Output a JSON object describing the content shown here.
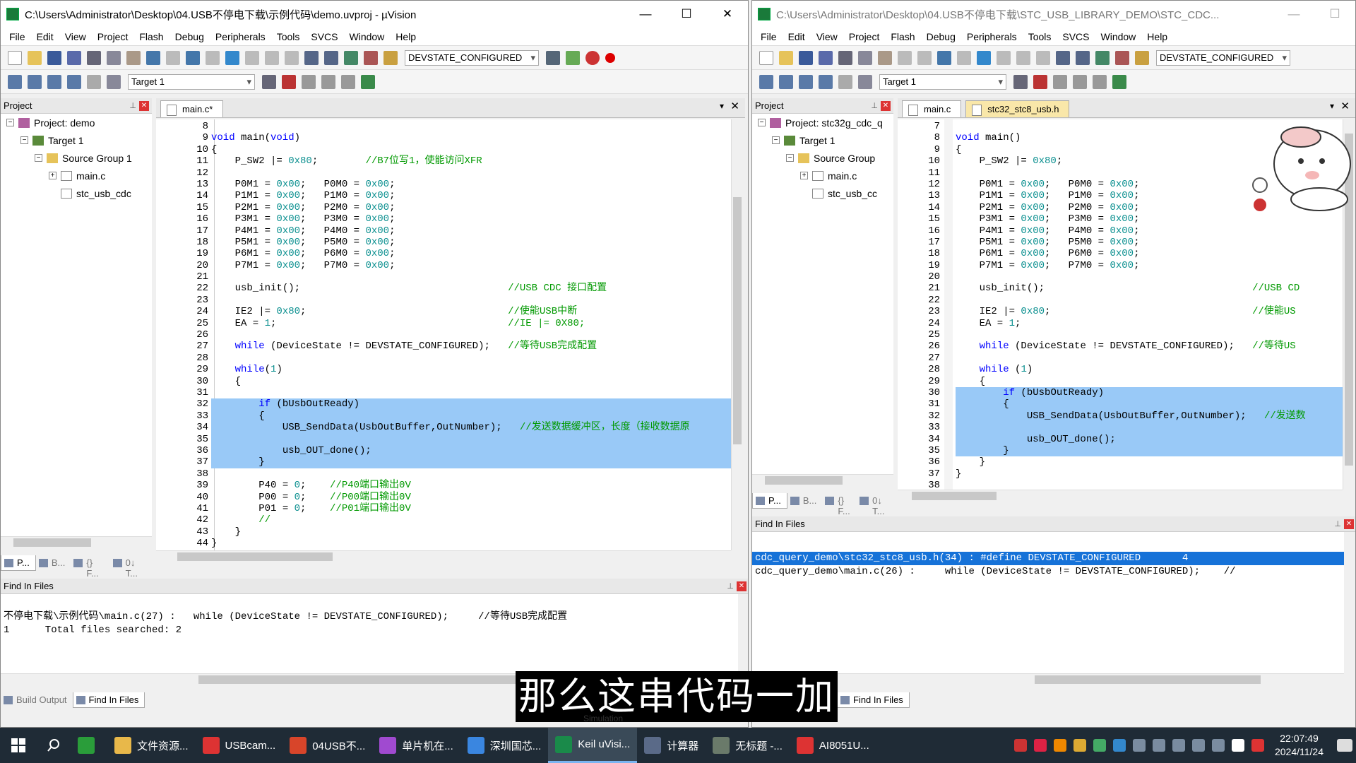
{
  "left_window": {
    "title": "C:\\Users\\Administrator\\Desktop\\04.USB不停电下载\\示例代码\\demo.uvproj - µVision",
    "controls": {
      "minimize": "—",
      "maximize": "☐",
      "close": "✕"
    },
    "menu": [
      "File",
      "Edit",
      "View",
      "Project",
      "Flash",
      "Debug",
      "Peripherals",
      "Tools",
      "SVCS",
      "Window",
      "Help"
    ],
    "find_combo": "DEVSTATE_CONFIGURED",
    "target_combo": "Target 1",
    "project_pane": {
      "header": "Project",
      "tree": [
        {
          "label": "Project: demo",
          "indent": 0,
          "icon": "project-icon",
          "exp": "−"
        },
        {
          "label": "Target 1",
          "indent": 1,
          "icon": "target-icon",
          "exp": "−"
        },
        {
          "label": "Source Group 1",
          "indent": 2,
          "icon": "folder-icon",
          "exp": "−"
        },
        {
          "label": "main.c",
          "indent": 3,
          "icon": "file-icon",
          "exp": "+"
        },
        {
          "label": "stc_usb_cdc",
          "indent": 3,
          "icon": "file-icon",
          "exp": ""
        }
      ],
      "bottom_tabs": [
        "P...",
        "B...",
        "{} F...",
        "0↓ T..."
      ]
    },
    "editor_tabs": [
      "main.c*"
    ],
    "code_start_line": 8,
    "code": [
      {
        "t": "",
        "cls": ""
      },
      {
        "t": "void main(void)",
        "cls": ""
      },
      {
        "t": "{",
        "cls": ""
      },
      {
        "t": "    P_SW2 |= 0x80;        //B7位写1，使能访问XFR",
        "cls": ""
      },
      {
        "t": "",
        "cls": ""
      },
      {
        "t": "    P0M1 = 0x00;   P0M0 = 0x00;",
        "cls": ""
      },
      {
        "t": "    P1M1 = 0x00;   P1M0 = 0x00;",
        "cls": ""
      },
      {
        "t": "    P2M1 = 0x00;   P2M0 = 0x00;",
        "cls": ""
      },
      {
        "t": "    P3M1 = 0x00;   P3M0 = 0x00;",
        "cls": ""
      },
      {
        "t": "    P4M1 = 0x00;   P4M0 = 0x00;",
        "cls": ""
      },
      {
        "t": "    P5M1 = 0x00;   P5M0 = 0x00;",
        "cls": ""
      },
      {
        "t": "    P6M1 = 0x00;   P6M0 = 0x00;",
        "cls": ""
      },
      {
        "t": "    P7M1 = 0x00;   P7M0 = 0x00;",
        "cls": ""
      },
      {
        "t": "",
        "cls": ""
      },
      {
        "t": "    usb_init();                                   //USB CDC 接口配置",
        "cls": ""
      },
      {
        "t": "",
        "cls": ""
      },
      {
        "t": "    IE2 |= 0x80;                                  //使能USB中断",
        "cls": ""
      },
      {
        "t": "    EA = 1;                                       //IE |= 0X80;",
        "cls": ""
      },
      {
        "t": "",
        "cls": ""
      },
      {
        "t": "    while (DeviceState != DEVSTATE_CONFIGURED);   //等待USB完成配置",
        "cls": ""
      },
      {
        "t": "",
        "cls": ""
      },
      {
        "t": "    while(1)",
        "cls": ""
      },
      {
        "t": "    {",
        "cls": ""
      },
      {
        "t": "",
        "cls": ""
      },
      {
        "t": "        if (bUsbOutReady)",
        "cls": "sel"
      },
      {
        "t": "        {",
        "cls": "sel"
      },
      {
        "t": "            USB_SendData(UsbOutBuffer,OutNumber);   //发送数据缓冲区，长度（接收数据原",
        "cls": "sel"
      },
      {
        "t": "",
        "cls": "sel"
      },
      {
        "t": "            usb_OUT_done();",
        "cls": "sel"
      },
      {
        "t": "        }",
        "cls": "sel"
      },
      {
        "t": "",
        "cls": ""
      },
      {
        "t": "        P40 = 0;    //P40端口输出0V",
        "cls": ""
      },
      {
        "t": "        P00 = 0;    //P00端口输出0V",
        "cls": ""
      },
      {
        "t": "        P01 = 0;    //P01端口输出0V",
        "cls": ""
      },
      {
        "t": "        //",
        "cls": ""
      },
      {
        "t": "    }",
        "cls": ""
      },
      {
        "t": "}",
        "cls": ""
      }
    ],
    "line_numbers": [
      "8",
      "9",
      "10",
      "11",
      "12",
      "13",
      "14",
      "15",
      "16",
      "17",
      "18",
      "19",
      "20",
      "21",
      "22",
      "23",
      "24",
      "25",
      "26",
      "27",
      "28",
      "29",
      "30",
      "31",
      "32",
      "33",
      "34",
      "35",
      "36",
      "37",
      "38",
      "39",
      "40",
      "41",
      "42",
      "43",
      "44"
    ],
    "find_panel": {
      "header": "Find In Files",
      "lines": [
        "",
        "不停电下载\\示例代码\\main.c(27) :   while (DeviceState != DEVSTATE_CONFIGURED);     //等待USB完成配置",
        "1      Total files searched: 2"
      ]
    },
    "bottom_tabs": [
      "Build Output",
      "Find In Files"
    ]
  },
  "right_window": {
    "title": "C:\\Users\\Administrator\\Desktop\\04.USB不停电下载\\STC_USB_LIBRARY_DEMO\\STC_CDC...",
    "menu": [
      "File",
      "Edit",
      "View",
      "Project",
      "Flash",
      "Debug",
      "Peripherals",
      "Tools",
      "SVCS",
      "Window",
      "Help"
    ],
    "find_combo": "DEVSTATE_CONFIGURED",
    "target_combo": "Target 1",
    "project_pane": {
      "header": "Project",
      "tree": [
        {
          "label": "Project: stc32g_cdc_q",
          "indent": 0,
          "icon": "project-icon",
          "exp": "−"
        },
        {
          "label": "Target 1",
          "indent": 1,
          "icon": "target-icon",
          "exp": "−"
        },
        {
          "label": "Source Group",
          "indent": 2,
          "icon": "folder-icon",
          "exp": "−"
        },
        {
          "label": "main.c",
          "indent": 3,
          "icon": "file-icon",
          "exp": "+"
        },
        {
          "label": "stc_usb_cc",
          "indent": 3,
          "icon": "file-icon",
          "exp": ""
        }
      ],
      "bottom_tabs": [
        "P...",
        "B...",
        "{} F...",
        "0↓ T..."
      ]
    },
    "editor_tabs": [
      "main.c",
      "stc32_stc8_usb.h"
    ],
    "code": [
      {
        "t": "",
        "cls": ""
      },
      {
        "t": "void main()",
        "cls": ""
      },
      {
        "t": "{",
        "cls": ""
      },
      {
        "t": "    P_SW2 |= 0x80;",
        "cls": ""
      },
      {
        "t": "",
        "cls": ""
      },
      {
        "t": "    P0M1 = 0x00;   P0M0 = 0x00;",
        "cls": ""
      },
      {
        "t": "    P1M1 = 0x00;   P1M0 = 0x00;",
        "cls": ""
      },
      {
        "t": "    P2M1 = 0x00;   P2M0 = 0x00;",
        "cls": ""
      },
      {
        "t": "    P3M1 = 0x00;   P3M0 = 0x00;",
        "cls": ""
      },
      {
        "t": "    P4M1 = 0x00;   P4M0 = 0x00;",
        "cls": ""
      },
      {
        "t": "    P5M1 = 0x00;   P5M0 = 0x00;",
        "cls": ""
      },
      {
        "t": "    P6M1 = 0x00;   P6M0 = 0x00;",
        "cls": ""
      },
      {
        "t": "    P7M1 = 0x00;   P7M0 = 0x00;",
        "cls": ""
      },
      {
        "t": "",
        "cls": ""
      },
      {
        "t": "    usb_init();                                   //USB CD",
        "cls": ""
      },
      {
        "t": "",
        "cls": ""
      },
      {
        "t": "    IE2 |= 0x80;                                  //使能US",
        "cls": ""
      },
      {
        "t": "    EA = 1;",
        "cls": ""
      },
      {
        "t": "",
        "cls": ""
      },
      {
        "t": "    while (DeviceState != DEVSTATE_CONFIGURED);   //等待US",
        "cls": ""
      },
      {
        "t": "",
        "cls": ""
      },
      {
        "t": "    while (1)",
        "cls": ""
      },
      {
        "t": "    {",
        "cls": ""
      },
      {
        "t": "        if (bUsbOutReady)",
        "cls": "sel"
      },
      {
        "t": "        {",
        "cls": "sel"
      },
      {
        "t": "            USB_SendData(UsbOutBuffer,OutNumber);   //发送数",
        "cls": "sel"
      },
      {
        "t": "",
        "cls": "sel"
      },
      {
        "t": "            usb_OUT_done();",
        "cls": "sel"
      },
      {
        "t": "        }",
        "cls": "sel"
      },
      {
        "t": "    }",
        "cls": ""
      },
      {
        "t": "}",
        "cls": ""
      },
      {
        "t": "",
        "cls": ""
      }
    ],
    "line_numbers": [
      "7",
      "8",
      "9",
      "10",
      "11",
      "12",
      "13",
      "14",
      "15",
      "16",
      "17",
      "18",
      "19",
      "20",
      "21",
      "22",
      "23",
      "24",
      "25",
      "26",
      "27",
      "28",
      "29",
      "30",
      "31",
      "32",
      "33",
      "34",
      "35",
      "36",
      "37",
      "38"
    ],
    "find_panel": {
      "header": "Find In Files",
      "lines": [
        "cdc_query_demo\\stc32_stc8_usb.h(34) : #define DEVSTATE_CONFIGURED       4",
        "cdc_query_demo\\main.c(26) :     while (DeviceState != DEVSTATE_CONFIGURED);    //"
      ]
    },
    "bottom_tabs": [
      "Find In Files"
    ]
  },
  "subtitle": "那么这串代码一加",
  "status_simulation": "Simulation",
  "taskbar": {
    "items": [
      {
        "label": "",
        "color": "#2a9d3a",
        "name": "wechat-icon"
      },
      {
        "label": "文件资源...",
        "color": "#e8b84a",
        "name": "explorer-icon"
      },
      {
        "label": "USBcam...",
        "color": "#d33",
        "name": "usbcam-icon"
      },
      {
        "label": "04USB不...",
        "color": "#d8452a",
        "name": "wps-icon"
      },
      {
        "label": "单片机在...",
        "color": "#a04ad0",
        "name": "mcu-icon"
      },
      {
        "label": "深圳国芯...",
        "color": "#3a86e0",
        "name": "chrome-icon"
      },
      {
        "label": "Keil uVisi...",
        "color": "#1a8a4a",
        "name": "keil-icon",
        "active": true
      },
      {
        "label": "计算器",
        "color": "#5a6a88",
        "name": "calculator-icon"
      },
      {
        "label": "无标题 -...",
        "color": "#6a7a6a",
        "name": "paint-icon"
      },
      {
        "label": "AI8051U...",
        "color": "#d33",
        "name": "pdf-icon"
      }
    ],
    "time": "22:07:49",
    "date": "2024/11/24"
  }
}
